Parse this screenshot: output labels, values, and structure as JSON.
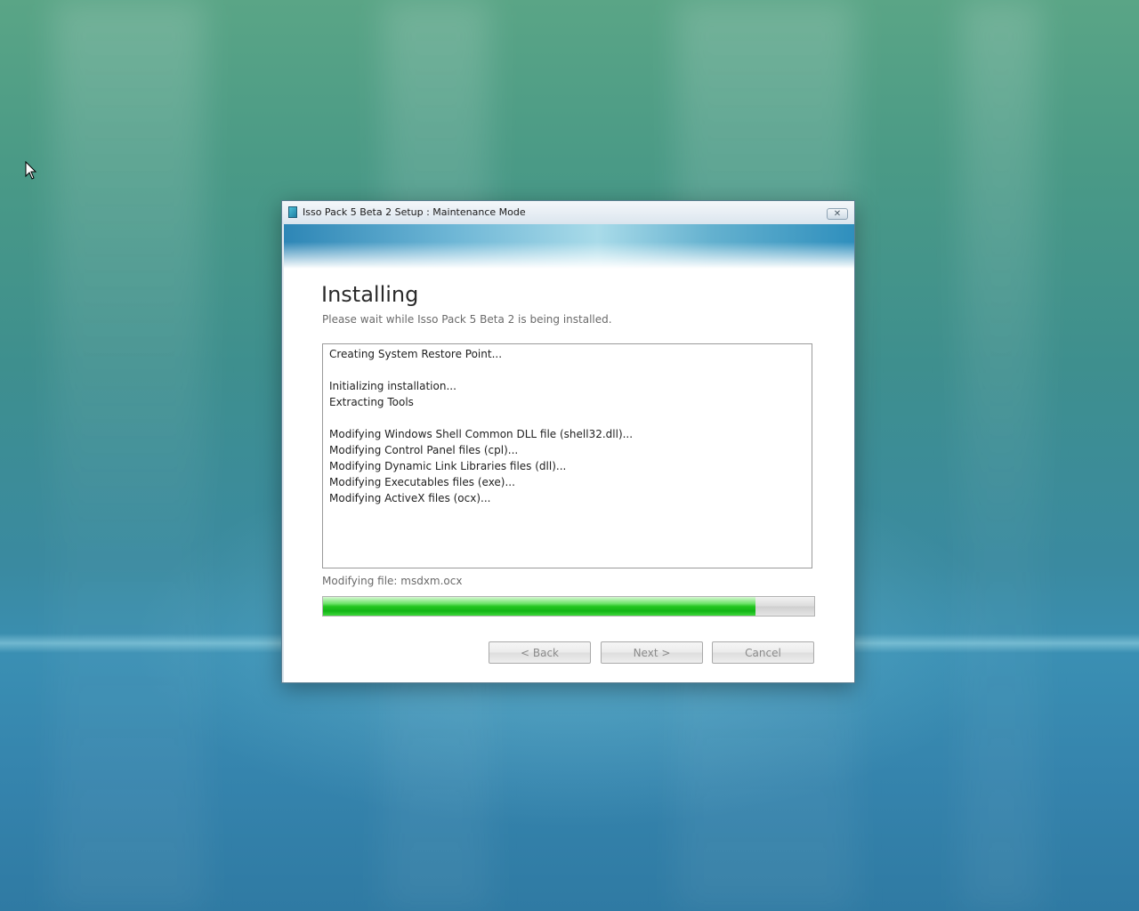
{
  "window": {
    "title": "Isso Pack 5 Beta 2 Setup : Maintenance Mode",
    "close_glyph": "✕"
  },
  "page": {
    "heading": "Installing",
    "subheading": "Please wait while Isso Pack 5 Beta 2 is being installed."
  },
  "log": {
    "lines": [
      "Creating System Restore Point...",
      "",
      "Initializing installation...",
      "Extracting Tools",
      "",
      "Modifying Windows Shell Common DLL file (shell32.dll)...",
      "Modifying Control Panel files (cpl)...",
      "Modifying Dynamic Link Libraries files (dll)...",
      "Modifying Executables files (exe)...",
      "Modifying ActiveX files (ocx)..."
    ]
  },
  "status": {
    "text": "Modifying file: msdxm.ocx",
    "progress_percent": 88
  },
  "buttons": {
    "back": "< Back",
    "next": "Next >",
    "cancel": "Cancel"
  },
  "colors": {
    "progress_fill": "#22c51f",
    "desktop_top": "#5aa586",
    "desktop_bottom": "#2f7aa3"
  },
  "icons": {
    "app": "setup-app-icon",
    "close": "close-icon",
    "cursor": "mouse-pointer-icon"
  }
}
